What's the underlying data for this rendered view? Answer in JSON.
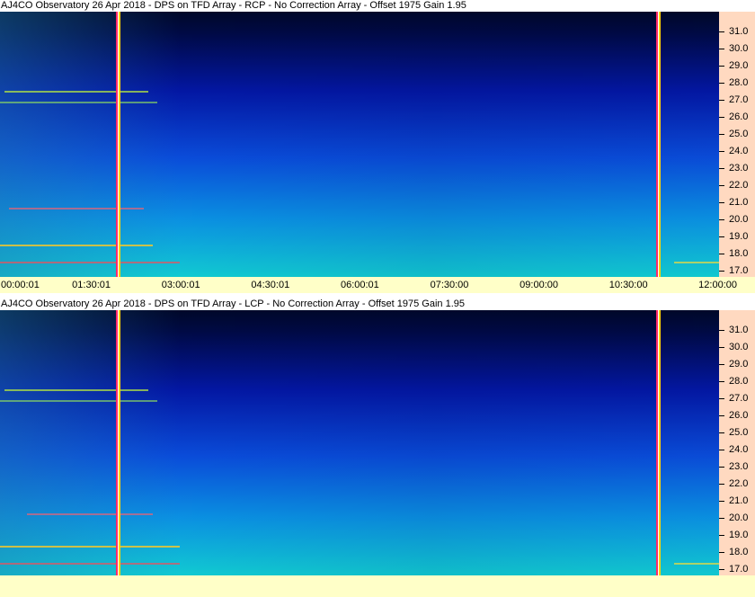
{
  "panels": [
    {
      "title": "AJ4CO Observatory 26 Apr 2018 - DPS on TFD Array  - RCP  -  No Correction Array  -  Offset 1975  Gain 1.95",
      "y_ticks": [
        "31.0",
        "30.0",
        "29.0",
        "28.0",
        "27.0",
        "26.0",
        "25.0",
        "24.0",
        "23.0",
        "22.0",
        "21.0",
        "20.0",
        "19.0",
        "18.0",
        "17.0"
      ],
      "x_ticks": [
        "00:00:01",
        "01:30:01",
        "03:00:01",
        "04:30:01",
        "06:00:01",
        "07:30:00",
        "09:00:00",
        "10:30:00",
        "12:00:00"
      ]
    },
    {
      "title": "AJ4CO Observatory 26 Apr 2018 - DPS on TFD Array  - LCP  -  No Correction Array  -  Offset 1975  Gain 1.95",
      "y_ticks": [
        "31.0",
        "30.0",
        "29.0",
        "28.0",
        "27.0",
        "26.0",
        "25.0",
        "24.0",
        "23.0",
        "22.0",
        "21.0",
        "20.0",
        "19.0",
        "18.0",
        "17.0"
      ],
      "x_ticks": []
    }
  ],
  "colors": {
    "y_axis_bg": "#ffd9c0",
    "x_axis_bg": "#ffffc8",
    "marker_red": "#ff2a6a",
    "marker_yellow": "#ffd400"
  }
}
